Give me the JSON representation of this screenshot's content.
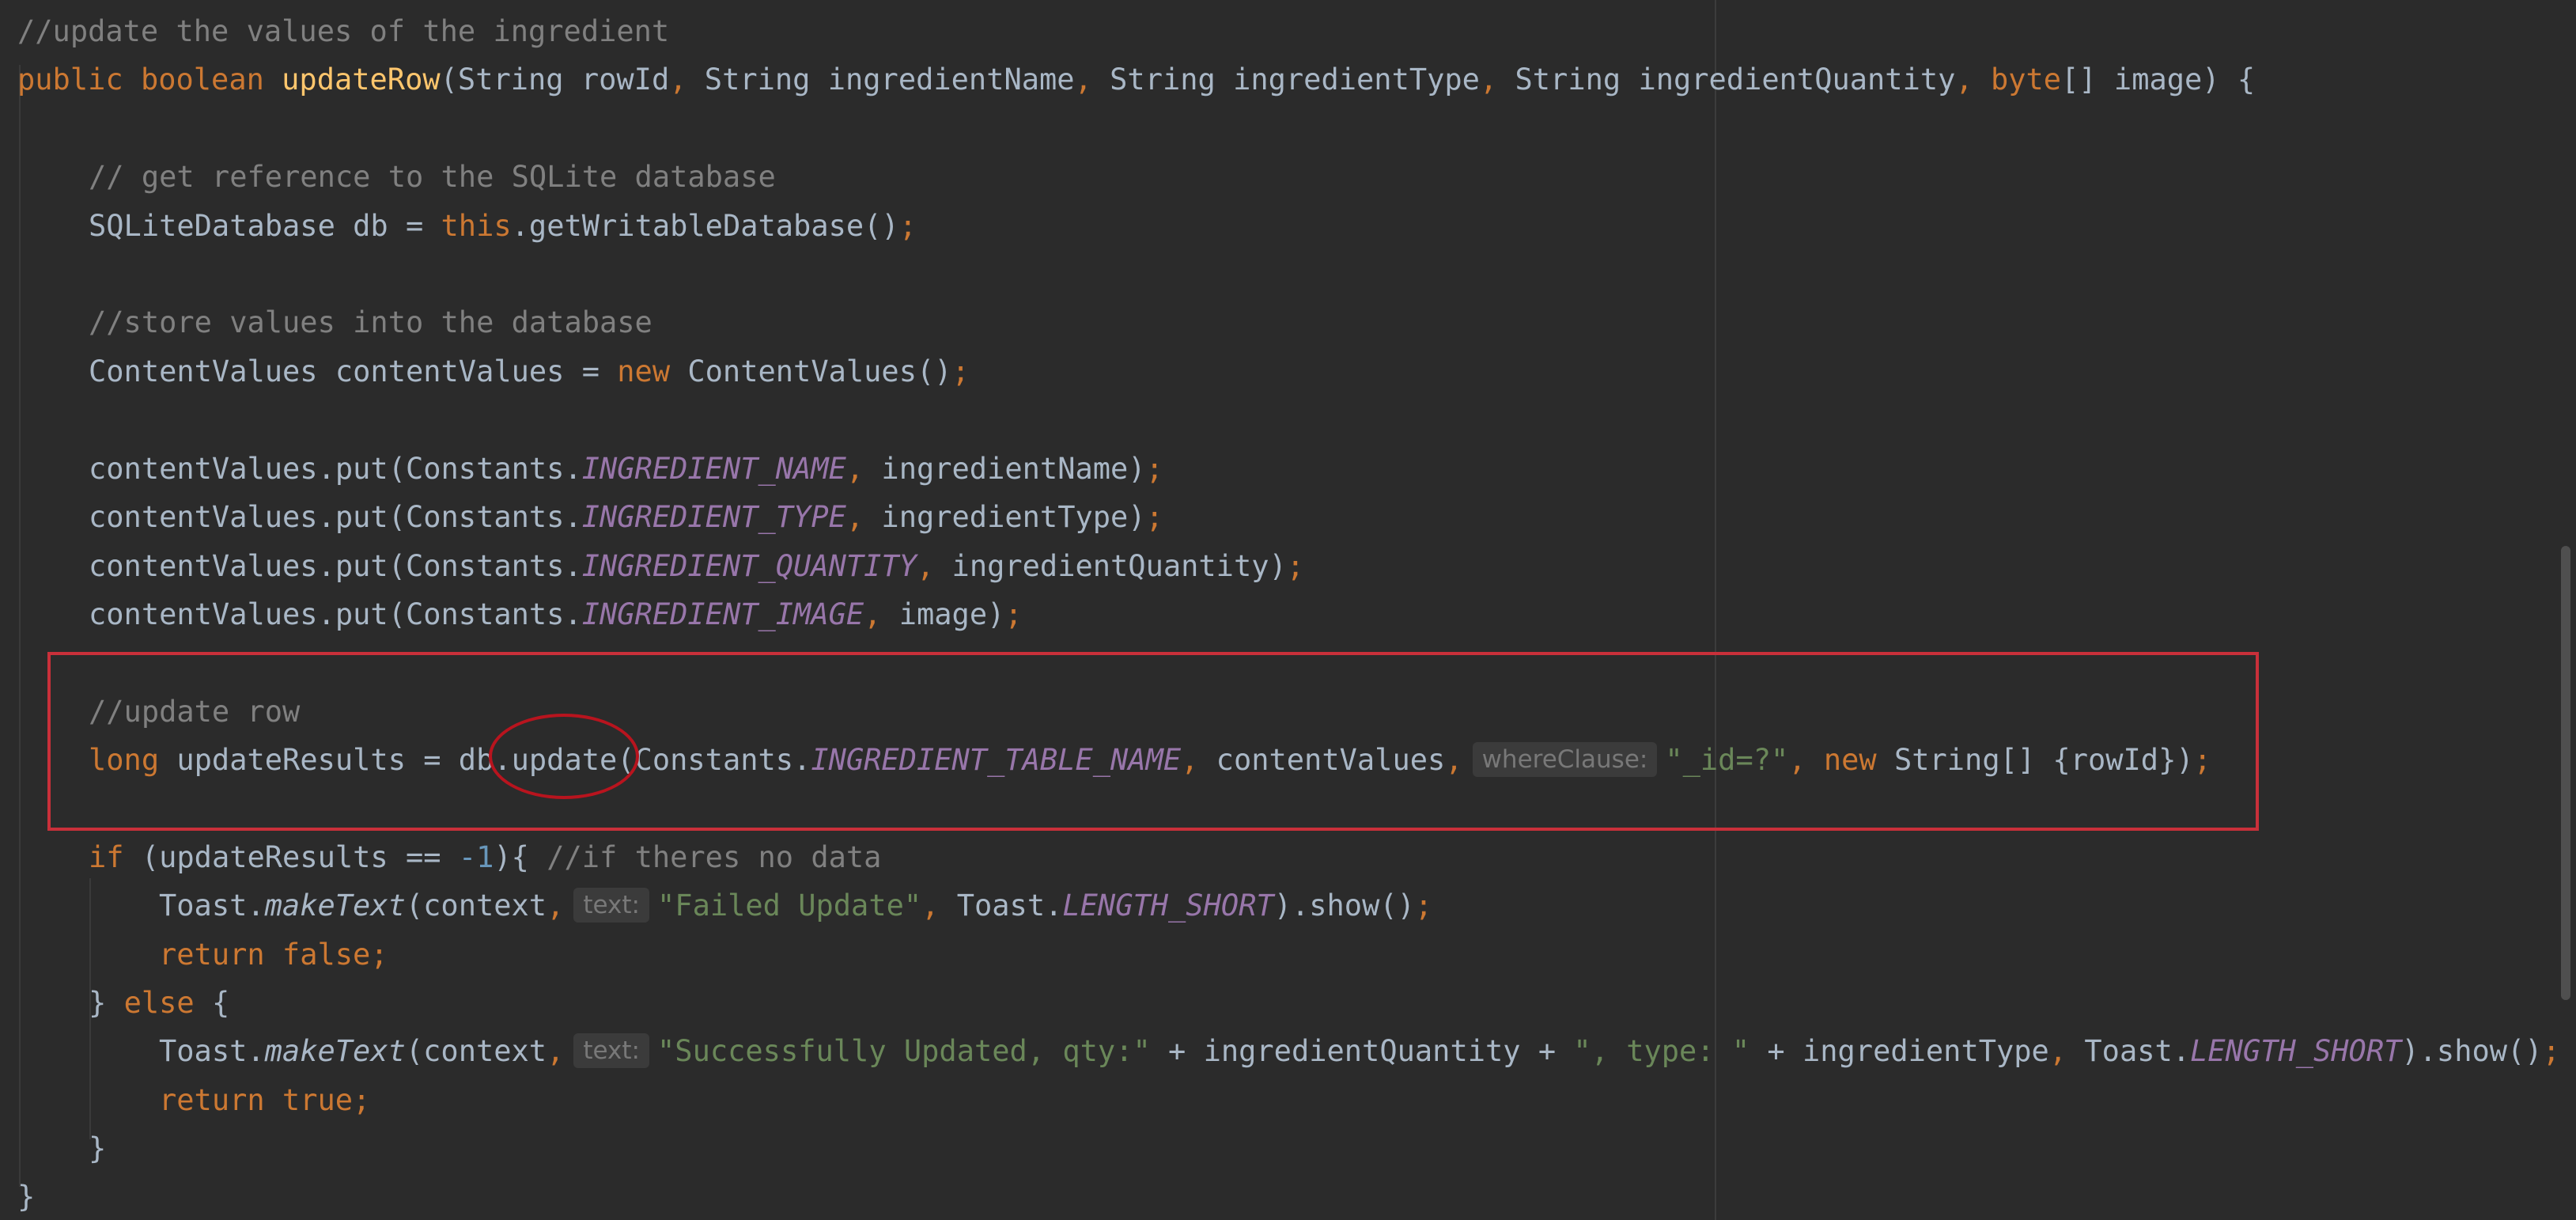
{
  "code": {
    "l1_comment": "//update the values of the ingredient",
    "l2": {
      "kw_public": "public",
      "kw_boolean": "boolean",
      "fn_name": "updateRow",
      "p1": "(String rowId",
      "c1": ",",
      "p2": " String ingredientName",
      "c2": ",",
      "p3": " String ingredientType",
      "c3": ",",
      "p4": " String ingredientQuantity",
      "c4": ",",
      "kw_byte": " byte",
      "p5": "[] image) {"
    },
    "l3_comment": "// get reference to the SQLite database",
    "l4": {
      "a": "SQLiteDatabase db = ",
      "kw_this": "this",
      "b": ".getWritableDatabase()",
      "semi": ";"
    },
    "l5_comment": "//store values into the database",
    "l6": {
      "a": "ContentValues contentValues = ",
      "kw_new": "new",
      "b": " ContentValues()",
      "semi": ";"
    },
    "puts": [
      {
        "pre": "contentValues.put(Constants.",
        "const": "INGREDIENT_NAME",
        "comma": ",",
        "arg": " ingredientName)",
        "semi": ";"
      },
      {
        "pre": "contentValues.put(Constants.",
        "const": "INGREDIENT_TYPE",
        "comma": ",",
        "arg": " ingredientType)",
        "semi": ";"
      },
      {
        "pre": "contentValues.put(Constants.",
        "const": "INGREDIENT_QUANTITY",
        "comma": ",",
        "arg": " ingredientQuantity)",
        "semi": ";"
      },
      {
        "pre": "contentValues.put(Constants.",
        "const": "INGREDIENT_IMAGE",
        "comma": ",",
        "arg": " image)",
        "semi": ";"
      }
    ],
    "l11_comment": "//update row",
    "l12": {
      "kw_long": "long",
      "a": " updateResults = db.update(Constants.",
      "const": "INGREDIENT_TABLE_NAME",
      "c1": ",",
      "b": " contentValues",
      "c2": ",",
      "hint": "whereClause:",
      "str": "\"_id=?\"",
      "c3": ",",
      "kw_new": " new",
      "c": " String[] {rowId})",
      "semi": ";"
    },
    "l13": {
      "kw_if": "if",
      "a": " (updateResults == ",
      "num": "-1",
      "b": "){ ",
      "comment": "//if theres no data"
    },
    "l14": {
      "a": "Toast.",
      "method": "makeText",
      "b": "(context",
      "c1": ",",
      "hint": "text:",
      "str": "\"Failed Update\"",
      "c2": ",",
      "c": " Toast.",
      "const": "LENGTH_SHORT",
      "d": ").show()",
      "semi": ";"
    },
    "l15": {
      "kw_return": "return",
      "kw_false": " false",
      "semi": ";"
    },
    "l16": {
      "a": "} ",
      "kw_else": "else",
      "b": " {"
    },
    "l17": {
      "a": "Toast.",
      "method": "makeText",
      "b": "(context",
      "c1": ",",
      "hint": "text:",
      "str1": "\"Successfully Updated, qty:\"",
      "c": " + ingredientQuantity + ",
      "str2": "\", type: \"",
      "d": " + ingredientType",
      "c2": ",",
      "e": " Toast.",
      "const": "LENGTH_SHORT",
      "f": ").show()",
      "semi": ";"
    },
    "l18": {
      "kw_return": "return",
      "kw_true": " true",
      "semi": ";"
    },
    "l19": "}",
    "l20": "}"
  },
  "colors": {
    "background": "#2b2b2b",
    "default_text": "#a9b7c6",
    "keyword": "#cc7832",
    "function": "#ffc66d",
    "comment": "#808080",
    "constant": "#9876aa",
    "string": "#6a8759",
    "number": "#6897bb",
    "annotation_red": "#c9303a"
  }
}
